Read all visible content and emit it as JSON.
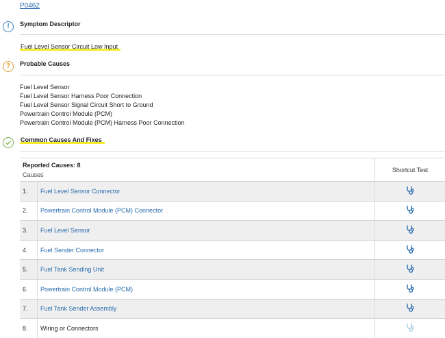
{
  "dtc_code": "P0462",
  "colors": {
    "link": "#2a6db0",
    "highlight": "#f6ea2a",
    "info": "#3a7bbf",
    "question": "#e0a030",
    "check": "#7aaa4a"
  },
  "symptom": {
    "title": "Symptom Descriptor",
    "descriptor": "Fuel Level Sensor Circuit Low Input",
    "icon": "info-icon"
  },
  "probable": {
    "title": "Probable Causes",
    "icon": "question-icon",
    "items": [
      "Fuel Level Sensor",
      "Fuel Level Sensor Harness Poor Connection",
      "Fuel Level Sensor Signal Circuit Short to Ground",
      "Powertrain Control Module (PCM)",
      "Powertrain Control Module (PCM) Harness Poor Connection"
    ]
  },
  "common": {
    "title": "Common Causes And Fixes",
    "icon": "check-icon",
    "reported": "Reported Causes: 8",
    "causes_label": "Causes",
    "shortcut_header": "Shortcut Test",
    "rows": [
      {
        "num": "1.",
        "name": "Fuel Level Sensor Connector",
        "link": true
      },
      {
        "num": "2.",
        "name": "Powertrain Control Module (PCM) Connector",
        "link": true
      },
      {
        "num": "3.",
        "name": "Fuel Level Sensor",
        "link": true
      },
      {
        "num": "4.",
        "name": "Fuel Sender Connector",
        "link": true
      },
      {
        "num": "5.",
        "name": "Fuel Tank Sending Unit",
        "link": true
      },
      {
        "num": "6.",
        "name": "Powertrain Control Module (PCM)",
        "link": true
      },
      {
        "num": "7.",
        "name": "Fuel Tank Sender Assembly",
        "link": true
      },
      {
        "num": "8.",
        "name": "Wiring or Connectors",
        "link": false
      }
    ]
  }
}
